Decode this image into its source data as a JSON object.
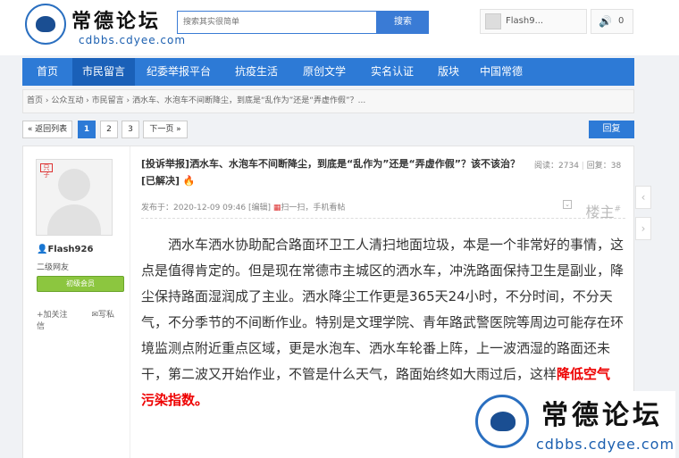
{
  "site": {
    "logo_cn": "常德论坛",
    "logo_en": "cdbbs.cdyee.com"
  },
  "search": {
    "placeholder": "搜索其实很简单",
    "button_label": "搜索"
  },
  "user": {
    "name": "Flash9...",
    "notify_count": "0"
  },
  "nav": {
    "items": [
      {
        "label": "首页"
      },
      {
        "label": "市民留言"
      },
      {
        "label": "纪委举报平台"
      },
      {
        "label": "抗疫生活"
      },
      {
        "label": "原创文学"
      },
      {
        "label": "实名认证"
      },
      {
        "label": "版块"
      },
      {
        "label": "中国常德"
      }
    ]
  },
  "breadcrumb": "首页 › 公众互动 › 市民留言 › 洒水车、水泡车不间断降尘，到底是“乱作为”还是“弄虚作假”？...",
  "pager": {
    "back_label": "« 返回列表",
    "pages": [
      "1",
      "2",
      "3"
    ],
    "next_label": "下一页 »",
    "reply_label": "回复"
  },
  "author": {
    "tag": "只子",
    "name": "Flash926",
    "level": "二级网友",
    "badge": "初级会员",
    "follow_label": "加关注",
    "message_label": "写私信"
  },
  "post": {
    "title_tag": "[投诉举报]",
    "title": "洒水车、水泡车不间断降尘，到底是“乱作为”还是“弄虚作假”？该不该治？",
    "title_status": "[已解决]",
    "fire_icon": "🔥",
    "views_label": "阅读：",
    "views": "2734",
    "replies_label": "回复：",
    "replies": "38",
    "published": "发布于：2020-12-09 09:46",
    "edit_label": "[编辑]",
    "scan_label": "扫一扫，手机看帖",
    "floor_label": "楼主",
    "floor_mark": "#",
    "body": "洒水车洒水协助配合路面环卫工人清扫地面垃圾，本是一个非常好的事情，这点是值得肯定的。但是现在常德市主城区的洒水车，冲洗路面保持卫生是副业，降尘保持路面湿润成了主业。洒水降尘工作更是365天24小时，不分时间，不分天气，不分季节的不间断作业。特别是文理学院、青年路武警医院等周边可能存在环境监测点附近重点区域，更是水泡车、洒水车轮番上阵，上一波洒湿的路面还未干，第二波又开始作业，不管是什么天气，路面始终如大雨过后，这样",
    "emphasis": "降低空气污染指数。"
  },
  "watermark": {
    "cn": "常德论坛",
    "en": "cdbbs.cdyee.com"
  },
  "colors": {
    "nav_bg": "#2d7ad6",
    "nav_active": "#1a60b8",
    "accent_red": "#e00000",
    "badge_green": "#8cc63f"
  }
}
